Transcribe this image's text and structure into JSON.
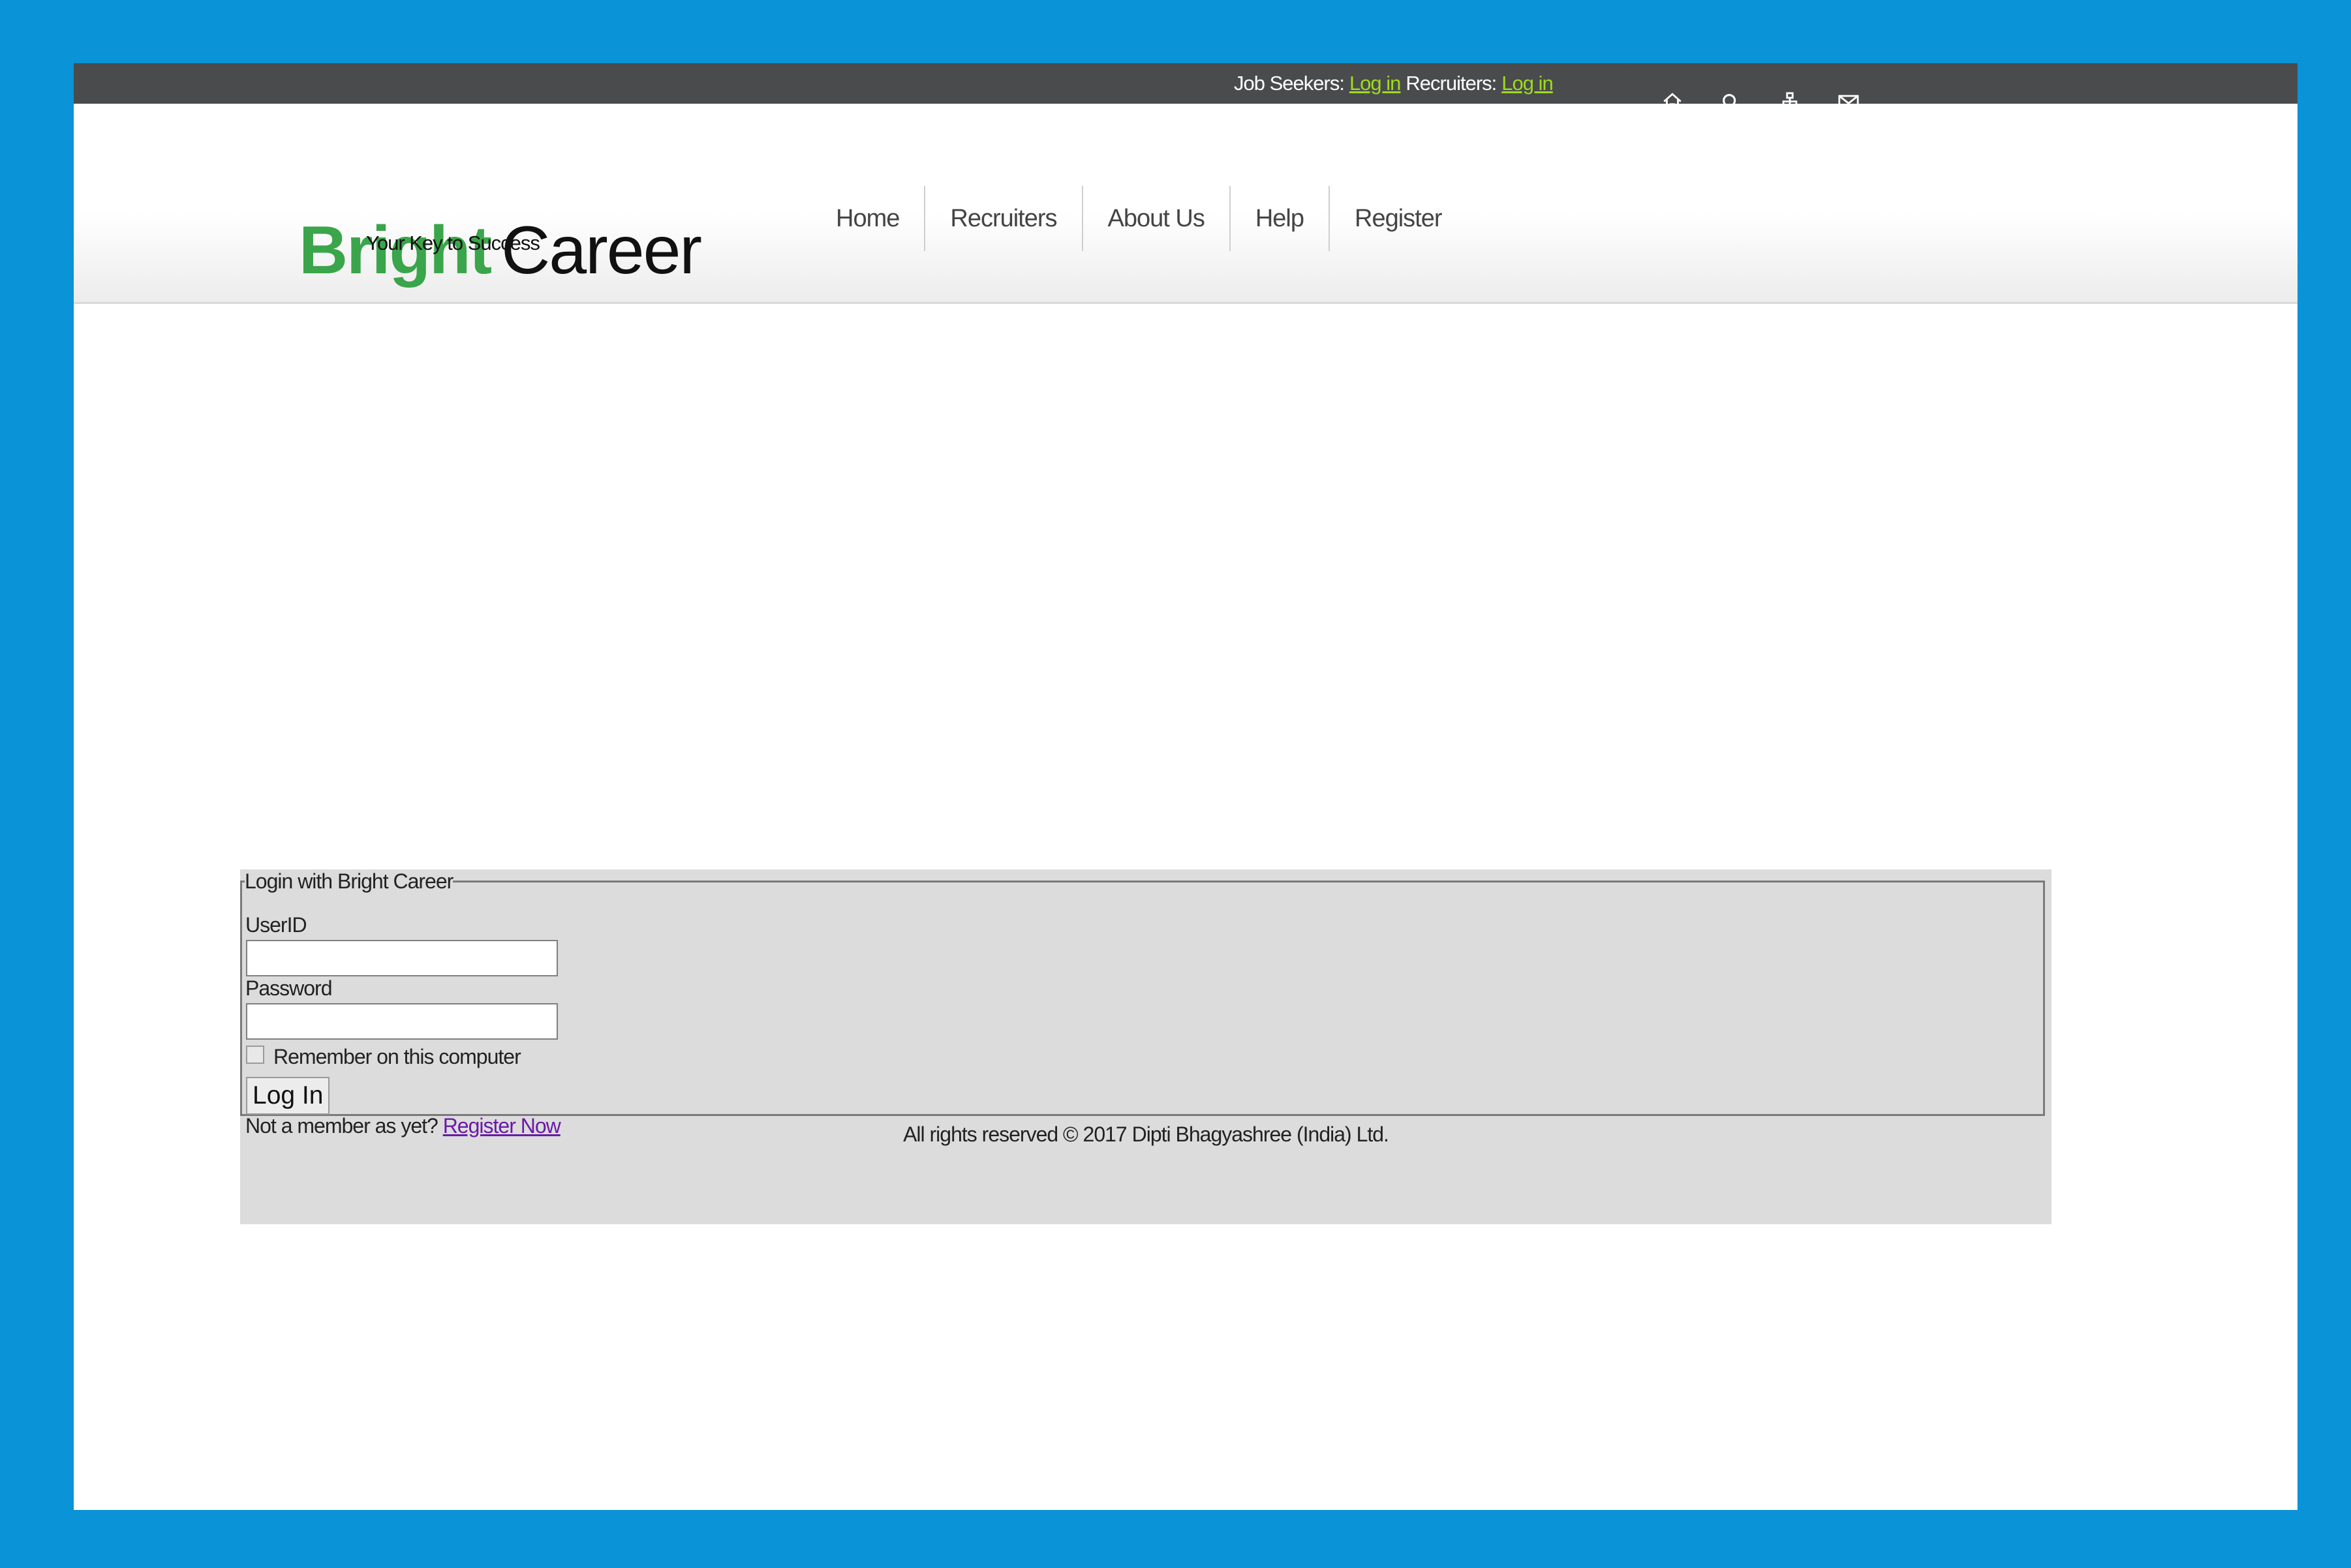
{
  "topbar": {
    "job_seekers_label": "Job Seekers:",
    "job_seekers_link": "Log in",
    "recruiters_label": "Recruiters:",
    "recruiters_link": "Log in",
    "icons": [
      "home-icon",
      "search-icon",
      "sitemap-icon",
      "mail-icon"
    ]
  },
  "header": {
    "logo_bright": "Bright",
    "logo_career": "Career",
    "tagline": "Your Key to Success",
    "nav": [
      "Home",
      "Recruiters",
      "About Us",
      "Help",
      "Register"
    ]
  },
  "login": {
    "legend": "Login with Bright Career",
    "userid_label": "UserID",
    "userid_value": "",
    "password_label": "Password",
    "password_value": "",
    "remember_label": "Remember on this computer",
    "remember_checked": false,
    "login_button": "Log In",
    "member_prompt": "Not a member as yet?",
    "register_link": "Register Now"
  },
  "footer": {
    "copyright": "All rights reserved © 2017 Dipti Bhagyashree (India) Ltd."
  },
  "colors": {
    "page_border": "#0a93d6",
    "topbar": "#4a4b4d",
    "topbar_link": "#9edb1a",
    "logo_green": "#3aa54a",
    "panel_bg": "#dcdcdc",
    "visited_link": "#6a1aa8"
  }
}
